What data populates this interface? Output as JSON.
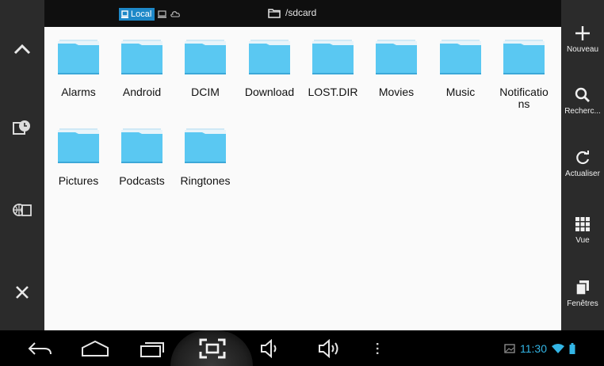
{
  "header": {
    "storage_tab_local": "Local",
    "path": "/sdcard"
  },
  "folders": [
    {
      "name": "Alarms"
    },
    {
      "name": "Android"
    },
    {
      "name": "DCIM"
    },
    {
      "name": "Download"
    },
    {
      "name": "LOST.DIR"
    },
    {
      "name": "Movies"
    },
    {
      "name": "Music"
    },
    {
      "name": "Notificatio ns"
    },
    {
      "name": "Pictures"
    },
    {
      "name": "Podcasts"
    },
    {
      "name": "Ringtones"
    }
  ],
  "actions": {
    "new_label": "Nouveau",
    "search_label": "Recherc...",
    "refresh_label": "Actualiser",
    "view_label": "Vue",
    "windows_label": "Fenêtres"
  },
  "left_rail_icons": [
    "chevron-up-icon",
    "history-icon",
    "storage-icon",
    "close-icon"
  ],
  "nav_icons": [
    "back-icon",
    "home-icon",
    "recent-apps-icon",
    "screenshot-icon",
    "volume-down-icon",
    "volume-up-icon",
    "menu-icon"
  ],
  "status_bar": {
    "time": "11:30"
  },
  "colors": {
    "accent": "#33b5e5",
    "folder": "#5ac8f2",
    "tab_active": "#1e88c8"
  }
}
